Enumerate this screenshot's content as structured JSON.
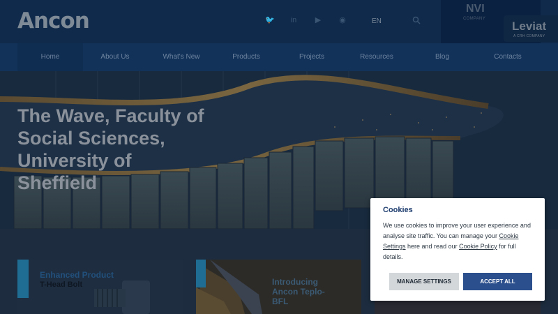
{
  "brand": {
    "logo": "Ancon",
    "corporate_logo": "NVI",
    "corporate_sub": "COMPANY"
  },
  "header": {
    "language": "EN"
  },
  "nav": {
    "items": [
      {
        "label": "Home"
      },
      {
        "label": "About Us"
      },
      {
        "label": "What's New"
      },
      {
        "label": "Products"
      },
      {
        "label": "Projects"
      },
      {
        "label": "Resources"
      },
      {
        "label": "Blog"
      },
      {
        "label": "Contacts"
      }
    ]
  },
  "hero": {
    "title": "The Wave, Faculty of Social Sciences, University of Sheffield",
    "badge": "Leviat",
    "badge_sub": "A CRH COMPANY"
  },
  "cards": {
    "card1_title": "Enhanced Product",
    "card1_subtitle": "T-Head Bolt",
    "card2_title": "Introducing Ancon Teplo-BFL"
  },
  "cookie": {
    "title": "Cookies",
    "text_1": "We use cookies to improve your user experience and analyse site traffic. You can manage your ",
    "link_settings": "Cookie Settings",
    "text_2": " here and read our ",
    "link_policy": "Cookie Policy",
    "text_3": " for full details.",
    "manage_button": "MANAGE SETTINGS",
    "accept_button": "ACCEPT ALL"
  },
  "colors": {
    "accent": "#2b4e8c",
    "header": "#0f2a4b",
    "nav": "#12325a"
  },
  "icons": [
    "twitter-icon",
    "linkedin-icon",
    "youtube-icon",
    "rss-icon",
    "search-icon"
  ]
}
